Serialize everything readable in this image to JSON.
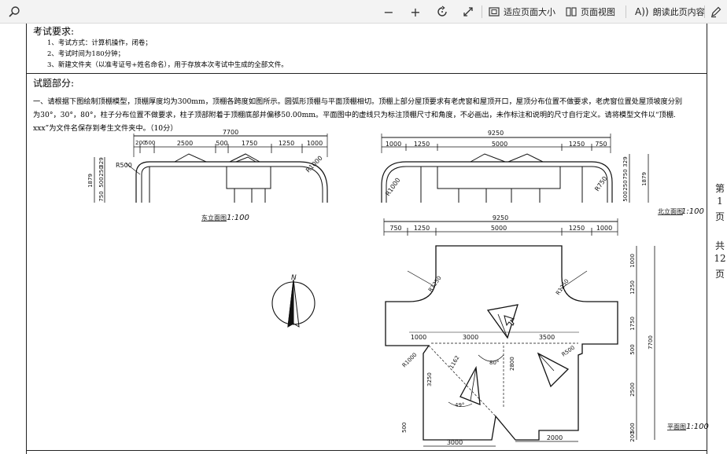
{
  "toolbar": {
    "search_icon": "search-icon",
    "zoom_out": "−",
    "zoom_in": "+",
    "fit_label": "适应页面大小",
    "page_view_label": "页面视图",
    "read_aloud_label": "朗读此页内容"
  },
  "doc": {
    "exam_req_title": "考试要求:",
    "req1": "1、考试方式：计算机操作，闭卷；",
    "req2": "2、考试时间为180分钟；",
    "req3": "3、新建文件夹（以准考证号+姓名命名），用于存放本次考试中生成的全部文件。",
    "section_title": "试题部分:",
    "q_line1": "一、请根据下图绘制顶棚模型，顶棚厚度均为300mm，顶棚各跨度如图所示。圆弧形顶棚与平面顶棚相切。顶棚上部分屋顶要求有老虎窗和屋顶开口，屋顶分布位置不做要求，老虎窗位置处屋顶坡度分别",
    "q_line2": "为30°，30°，80°，柱子分布位置不做要求，柱子顶部附着于顶棚底部并偏移50.00mm。平面图中的虚线只为标注顶棚尺寸和角度，不必画出，未作标注和说明的尺寸自行定义。请将模型文件以“顶棚.",
    "q_line3": "xxx”为文件名保存到考生文件夹中。（10分）"
  },
  "drawing": {
    "east": {
      "total": "7700",
      "dims": [
        "200",
        "500",
        "2500",
        "500",
        "1750",
        "1250",
        "1000"
      ],
      "vert": [
        "1879",
        "329",
        "250",
        "500",
        "750"
      ],
      "radii": [
        "R500",
        "R1000"
      ],
      "label": "东立面图",
      "scale": "1:100"
    },
    "north": {
      "total": "9250",
      "dims": [
        "1000",
        "1250",
        "5000",
        "1250",
        "750"
      ],
      "vert": [
        "329",
        "750",
        "250",
        "500",
        "1879"
      ],
      "radii": [
        "R1000",
        "R750"
      ],
      "label": "北立面图",
      "scale": "1:100"
    },
    "plan": {
      "total": "9250",
      "top_dims": [
        "750",
        "1250",
        "5000",
        "1250",
        "1000"
      ],
      "mid_dims": [
        "1000",
        "3000",
        "3500"
      ],
      "right_dims": [
        "1000",
        "1250",
        "1750",
        "500",
        "2500",
        "500",
        "200"
      ],
      "right_total": "7700",
      "bottom_dims": [
        "3000",
        "2000"
      ],
      "misc": [
        "R1250",
        "R1250",
        "R1000",
        "R500",
        "1162",
        "3250",
        "80°",
        "2800",
        "49°",
        "500"
      ],
      "label": "平面图",
      "scale": "1:100"
    },
    "compass": "N"
  },
  "sidebar": {
    "page_chars": [
      "第",
      "1",
      "页"
    ],
    "total_chars": [
      "共",
      "12",
      "页"
    ]
  }
}
